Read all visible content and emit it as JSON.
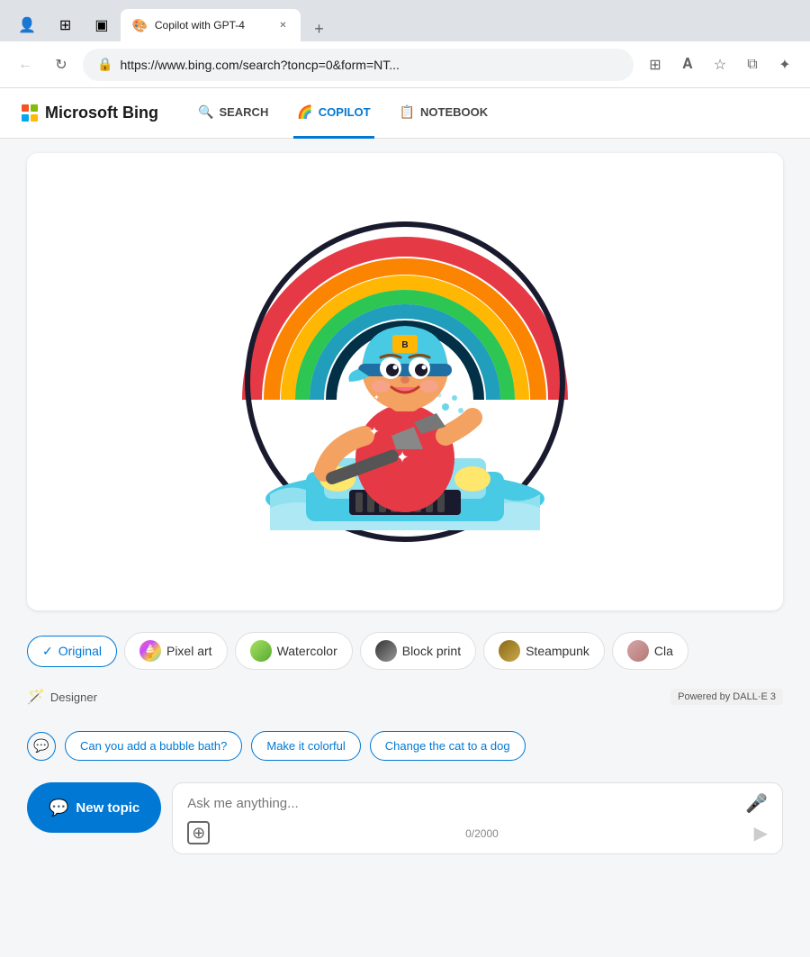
{
  "browser": {
    "tab_title": "Copilot with GPT-4",
    "tab_favicon": "🌐",
    "address": "https://www.bing.com/search?toncp=0&form=NT...",
    "new_tab_icon": "+"
  },
  "bing_nav": {
    "logo_text": "Microsoft Bing",
    "search_label": "SEARCH",
    "copilot_label": "COPILOT",
    "notebook_label": "NOTEBOOK"
  },
  "style_picker": {
    "options": [
      {
        "id": "original",
        "label": "Original",
        "active": true
      },
      {
        "id": "pixel_art",
        "label": "Pixel art",
        "active": false
      },
      {
        "id": "watercolor",
        "label": "Watercolor",
        "active": false
      },
      {
        "id": "block_print",
        "label": "Block print",
        "active": false
      },
      {
        "id": "steampunk",
        "label": "Steampunk",
        "active": false
      },
      {
        "id": "cla",
        "label": "Cla",
        "active": false
      }
    ]
  },
  "designer": {
    "label": "Designer",
    "powered_by": "Powered by DALL·E 3"
  },
  "suggestions": {
    "icon_label": "chat",
    "chips": [
      "Can you add a bubble bath?",
      "Make it colorful",
      "Change the cat to a dog"
    ]
  },
  "input": {
    "placeholder": "Ask me anything...",
    "new_topic_label": "New topic",
    "char_count": "0/2000"
  }
}
